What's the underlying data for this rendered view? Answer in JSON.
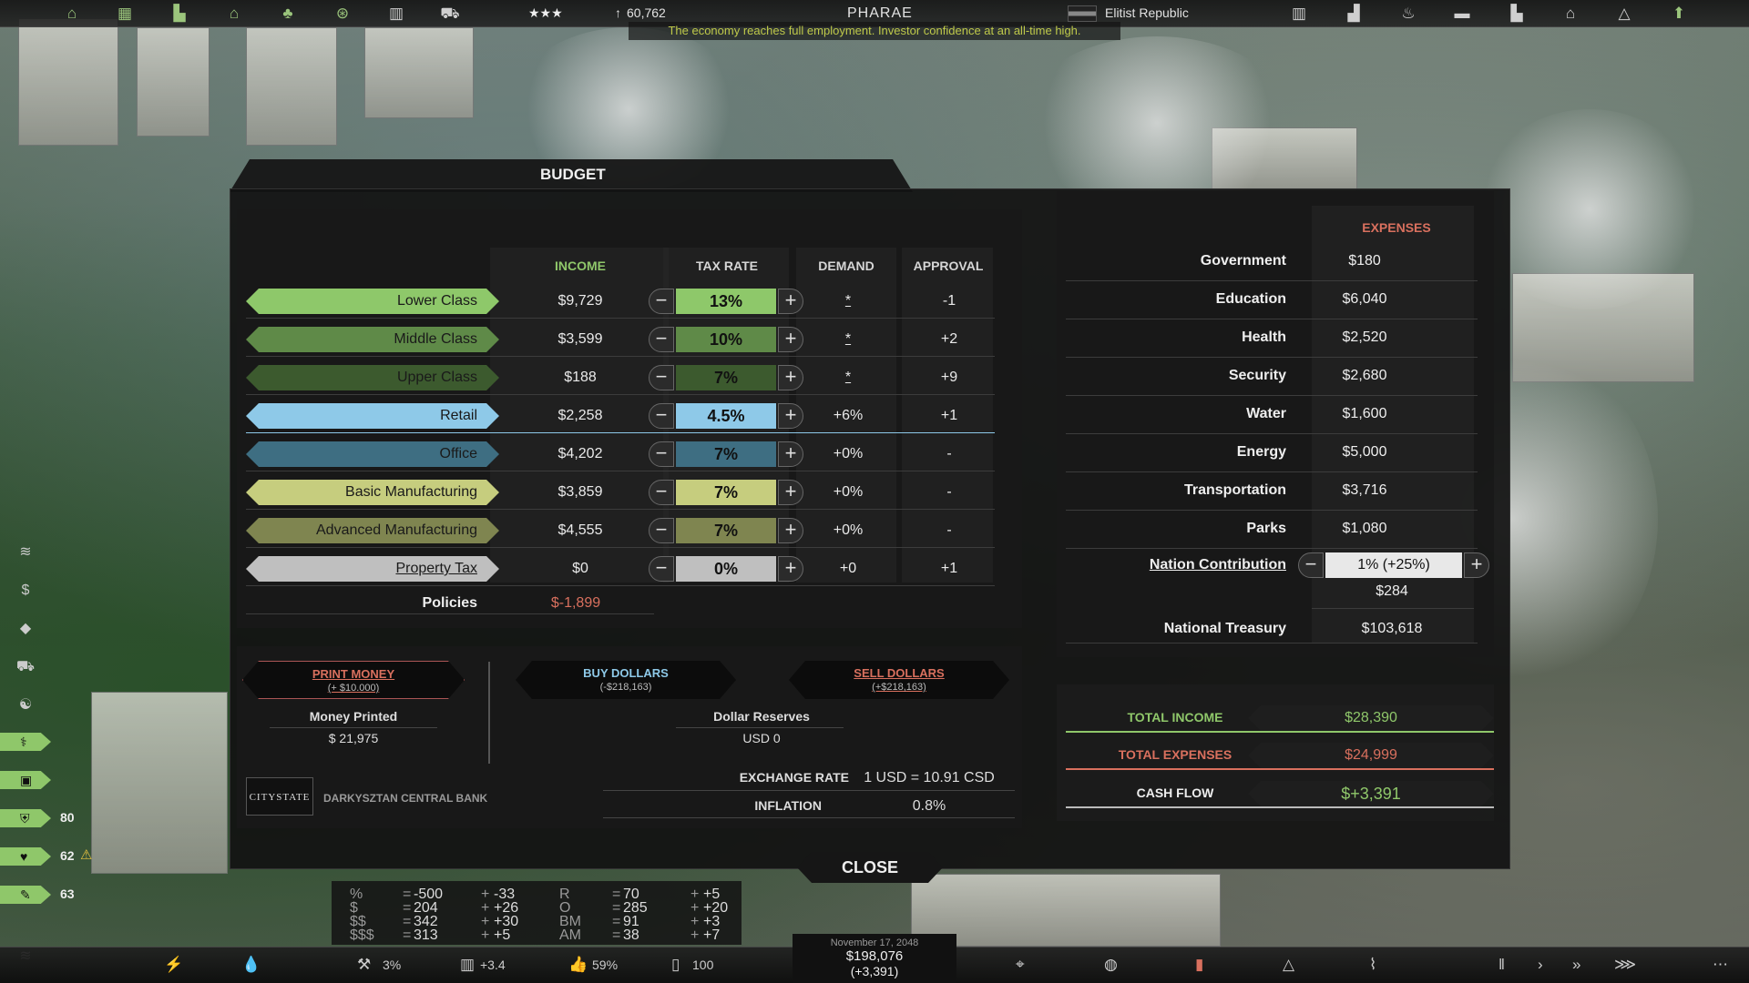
{
  "topbar": {
    "stars": "★★★",
    "population": "60,762",
    "city_name": "PHARAE",
    "government": "Elitist Republic",
    "ticker": "The economy reaches full employment. Investor confidence at an all-time high."
  },
  "panel": {
    "title": "BUDGET",
    "headers": {
      "income": "INCOME",
      "tax_rate": "TAX RATE",
      "demand": "DEMAND",
      "approval": "APPROVAL",
      "expenses": "EXPENSES"
    },
    "rows": [
      {
        "label": "Lower Class",
        "income": "$9,729",
        "tax": "13%",
        "demand": "*",
        "approval": "-1",
        "color": "#8ec86a",
        "stepcolor": "#8ec86a"
      },
      {
        "label": "Middle Class",
        "income": "$3,599",
        "tax": "10%",
        "demand": "*",
        "approval": "+2",
        "color": "#5f8a48",
        "stepcolor": "#5f8a48"
      },
      {
        "label": "Upper Class",
        "income": "$188",
        "tax": "7%",
        "demand": "*",
        "approval": "+9",
        "color": "#3c5a2e",
        "stepcolor": "#3c5a2e"
      },
      {
        "label": "Retail",
        "income": "$2,258",
        "tax": "4.5%",
        "demand": "+6%",
        "approval": "+1",
        "color": "#8ec9e8",
        "stepcolor": "#8ec9e8"
      },
      {
        "label": "Office",
        "income": "$4,202",
        "tax": "7%",
        "demand": "+0%",
        "approval": "-",
        "color": "#3e6e82",
        "stepcolor": "#3e6e82"
      },
      {
        "label": "Basic Manufacturing",
        "income": "$3,859",
        "tax": "7%",
        "demand": "+0%",
        "approval": "-",
        "color": "#c6cd7e",
        "stepcolor": "#c6cd7e"
      },
      {
        "label": "Advanced Manufacturing",
        "income": "$4,555",
        "tax": "7%",
        "demand": "+0%",
        "approval": "-",
        "color": "#7f8550",
        "stepcolor": "#7f8550"
      },
      {
        "label": "Property Tax",
        "income": "$0",
        "tax": "0%",
        "demand": "+0",
        "approval": "+1",
        "color": "#bfbfbf",
        "stepcolor": "#bfbfbf"
      }
    ],
    "policies": {
      "label": "Policies",
      "value": "$-1,899"
    },
    "expenses": [
      {
        "label": "Government",
        "value": "$180"
      },
      {
        "label": "Education",
        "value": "$6,040"
      },
      {
        "label": "Health",
        "value": "$2,520"
      },
      {
        "label": "Security",
        "value": "$2,680"
      },
      {
        "label": "Water",
        "value": "$1,600"
      },
      {
        "label": "Energy",
        "value": "$5,000"
      },
      {
        "label": "Transportation",
        "value": "$3,716"
      },
      {
        "label": "Parks",
        "value": "$1,080"
      }
    ],
    "nation_contribution": {
      "label": "Nation Contribution",
      "rate": "1% (+25%)",
      "value": "$284"
    },
    "national_treasury": {
      "label": "National Treasury",
      "value": "$103,618"
    },
    "print_money": {
      "label": "PRINT MONEY",
      "sub": "(+ $10.000)"
    },
    "money_printed": {
      "label": "Money Printed",
      "value": "$ 21,975"
    },
    "buy_dollars": {
      "label": "BUY DOLLARS",
      "sub": "(-$218,163)"
    },
    "sell_dollars": {
      "label": "SELL DOLLARS",
      "sub": "(+$218,163)"
    },
    "dollar_reserves": {
      "label": "Dollar Reserves",
      "value": "USD 0"
    },
    "bank_logo": "CITYSTATE",
    "bank_name": "DARKYSZTAN CENTRAL BANK",
    "exchange_rate": {
      "label": "EXCHANGE RATE",
      "value": "1 USD = 10.91 CSD"
    },
    "inflation": {
      "label": "INFLATION",
      "value": "0.8%"
    },
    "total_income": {
      "label": "TOTAL INCOME",
      "value": "$28,390"
    },
    "total_expenses": {
      "label": "TOTAL EXPENSES",
      "value": "$24,999"
    },
    "cash_flow": {
      "label": "CASH FLOW",
      "value": "$+3,391"
    },
    "close": "CLOSE"
  },
  "sidebar": {
    "values": [
      "80",
      "62",
      "63"
    ]
  },
  "stats": {
    "left": [
      [
        "%",
        "=",
        "-500",
        "+",
        "-33"
      ],
      [
        "$",
        "=",
        "204",
        "+",
        "+26"
      ],
      [
        "$$",
        "=",
        "342",
        "+",
        "+30"
      ],
      [
        "$$$",
        "=",
        "313",
        "+",
        "+5"
      ]
    ],
    "right": [
      [
        "R",
        "=",
        "70",
        "+",
        "+5"
      ],
      [
        "O",
        "=",
        "285",
        "+",
        "+20"
      ],
      [
        "BM",
        "=",
        "91",
        "+",
        "+3"
      ],
      [
        "AM",
        "=",
        "38",
        "+",
        "+7"
      ]
    ]
  },
  "bottom": {
    "unemployment": "3%",
    "income_rate": "+3.4",
    "approval": "59%",
    "tower": "100",
    "date": "November 17, 2048",
    "money": "$198,076",
    "money_delta": "(+3,391)"
  },
  "colors": {
    "accent_green": "#8fc76a",
    "accent_red": "#d9705e",
    "retail_blue": "#8ec9e8"
  }
}
